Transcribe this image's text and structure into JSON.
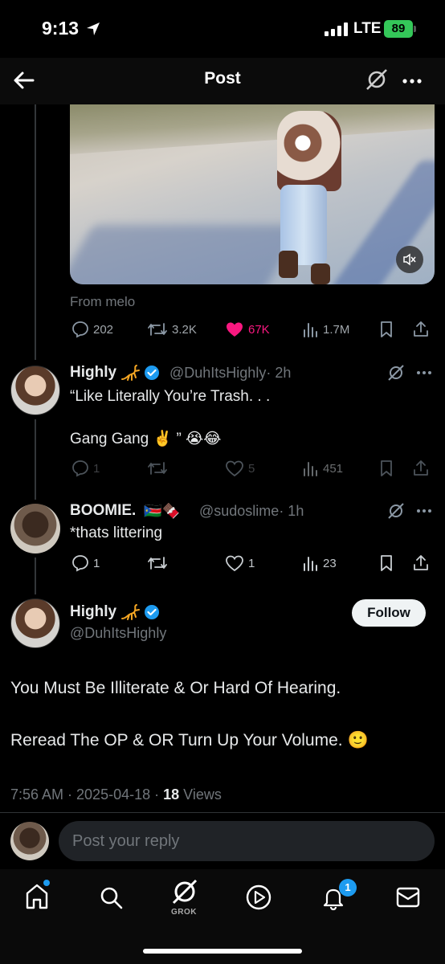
{
  "status_bar": {
    "time": "9:13",
    "network": "LTE",
    "battery": "89"
  },
  "nav": {
    "title": "Post"
  },
  "original_post": {
    "from": "From melo",
    "replies": "202",
    "reposts": "3.2K",
    "likes": "67K",
    "views": "1.7M",
    "like_color": "#f91880"
  },
  "reply1": {
    "name": "Highly",
    "handle": "@DuhItsHighly",
    "time": "· 2h",
    "line1": "“Like Literally You’re Trash. . .",
    "line2": "Gang Gang ✌️ ” 😭😂",
    "replies": "1",
    "likes": "5",
    "views": "451"
  },
  "reply2": {
    "name": "BOOMIE.",
    "flags": "🇸🇸🍫",
    "handle": "@sudoslime",
    "time": "· 1h",
    "text": "*thats littering",
    "replies": "1",
    "likes": "1",
    "views": "23"
  },
  "focused_post": {
    "name": "Highly",
    "handle": "@DuhItsHighly",
    "follow_label": "Follow",
    "line1": "You Must Be Illiterate & Or Hard Of Hearing.",
    "line2": "Reread The OP & OR Turn Up Your Volume. 🙂",
    "time": "7:56 AM · 2025-04-18 · ",
    "views_count": "18",
    "views_label": " Views"
  },
  "reply_box": {
    "placeholder": "Post your reply"
  },
  "tabbar": {
    "grok_label": "GROK",
    "notifications_badge": "1"
  },
  "colors": {
    "accent": "#1d9bf0",
    "verified": "#1d9bf0",
    "scorpion": "#f5a623"
  }
}
